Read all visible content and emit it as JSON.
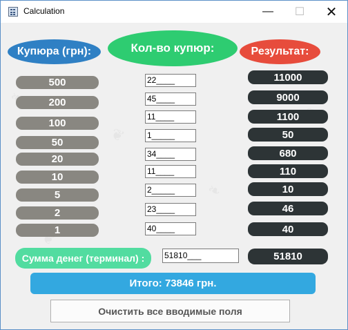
{
  "window": {
    "title": "Calculation",
    "minimize_glyph": "—",
    "maximize_glyph": "☐",
    "close_glyph": "✕"
  },
  "colors": {
    "denom_header": "#2f80c4",
    "count_header": "#2ecc71",
    "result_header": "#e74c3c",
    "denom_pill": "#898781",
    "result_pill": "#2d3436",
    "sum_label": "#52dca0",
    "total_bar": "#33a8e0"
  },
  "headers": {
    "denomination": "Купюра (грн):",
    "count": "Кол-во купюр:",
    "result": "Результат:"
  },
  "rows": [
    {
      "denomination": "500",
      "count": "22____",
      "result": "11000"
    },
    {
      "denomination": "200",
      "count": "45____",
      "result": "9000"
    },
    {
      "denomination": "100",
      "count": "11____",
      "result": "1100"
    },
    {
      "denomination": "50",
      "count": "1_____",
      "result": "50"
    },
    {
      "denomination": "20",
      "count": "34____",
      "result": "680"
    },
    {
      "denomination": "10",
      "count": "11____",
      "result": "110"
    },
    {
      "denomination": "5",
      "count": "2_____",
      "result": "10"
    },
    {
      "denomination": "2",
      "count": "23____",
      "result": "46"
    },
    {
      "denomination": "1",
      "count": "40____",
      "result": "40"
    }
  ],
  "terminal": {
    "label": "Сумма денег (терминал) :",
    "value": "51810___",
    "result": "51810"
  },
  "total": "Итого: 73846 грн.",
  "clear_button": "Очистить все вводимые поля"
}
